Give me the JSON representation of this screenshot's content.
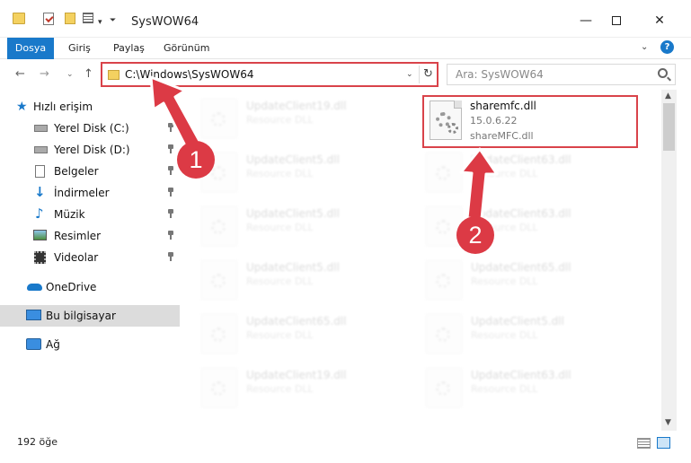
{
  "window": {
    "title": "SysWOW64"
  },
  "ribbon": {
    "tabs": [
      "Dosya",
      "Giriş",
      "Paylaş",
      "Görünüm"
    ],
    "help": "?"
  },
  "address": {
    "path": "C:\\Windows\\SysWOW64",
    "search_placeholder": "Ara: SysWOW64"
  },
  "sidebar": {
    "items": [
      {
        "label": "Hızlı erişim"
      },
      {
        "label": "Yerel Disk (C:)"
      },
      {
        "label": "Yerel Disk (D:)"
      },
      {
        "label": "Belgeler"
      },
      {
        "label": "İndirmeler"
      },
      {
        "label": "Müzik"
      },
      {
        "label": "Resimler"
      },
      {
        "label": "Videolar"
      },
      {
        "label": "OneDrive"
      },
      {
        "label": "Bu bilgisayar"
      },
      {
        "label": "Ağ"
      }
    ]
  },
  "files": {
    "highlighted": {
      "name": "sharemfc.dll",
      "version": "15.0.6.22",
      "description": "shareMFC.dll"
    },
    "left_col": [
      {
        "name": "UpdateClient19.dll",
        "type": "Resource DLL"
      },
      {
        "name": "UpdateClient5.dll",
        "type": "Resource DLL"
      },
      {
        "name": "UpdateClient5.dll",
        "type": "Resource DLL"
      },
      {
        "name": "UpdateClient5.dll",
        "type": "Resource DLL"
      },
      {
        "name": "UpdateClient65.dll",
        "type": "Resource DLL"
      },
      {
        "name": "UpdateClient19.dll",
        "type": "Resource DLL"
      }
    ],
    "right_col": [
      {
        "name": "UpdateClient63.dll",
        "type": "Resource DLL"
      },
      {
        "name": "UpdateClient63.dll",
        "type": "Resource DLL"
      },
      {
        "name": "UpdateClient65.dll",
        "type": "Resource DLL"
      },
      {
        "name": "UpdateClient5.dll",
        "type": "Resource DLL"
      },
      {
        "name": "UpdateClient63.dll",
        "type": "Resource DLL"
      }
    ]
  },
  "status": {
    "count": "192 öğe"
  },
  "annotations": {
    "step1": "1",
    "step2": "2"
  },
  "colors": {
    "accent": "#1979ca",
    "highlight": "#d9434a",
    "badge": "#dc3a45"
  }
}
